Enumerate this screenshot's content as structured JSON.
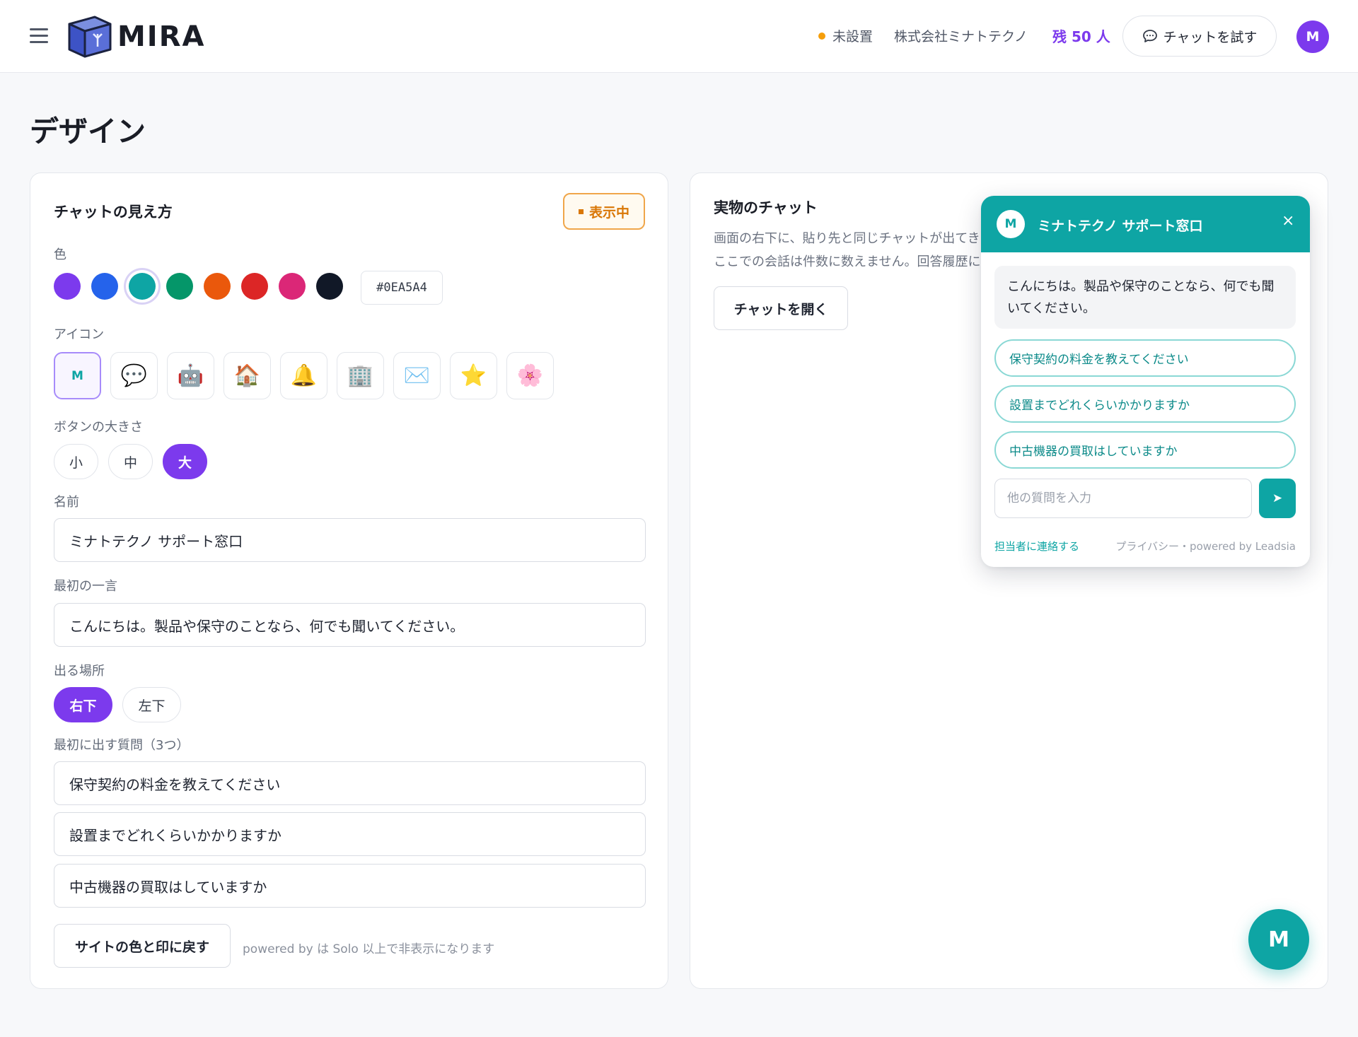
{
  "header": {
    "brand": "MIRA",
    "status": "未設置",
    "company": "株式会社ミナトテクノ",
    "remaining": "残 50 人",
    "try_chat": "チャットを試す",
    "avatar_initial": "M"
  },
  "page": {
    "title": "デザイン"
  },
  "appearance": {
    "title": "チャットの見え方",
    "badge": "表示中",
    "color_label": "色",
    "colors": [
      "#7c3aed",
      "#2563eb",
      "#0ea5a4",
      "#059669",
      "#ea580c",
      "#dc2626",
      "#db2777",
      "#111827"
    ],
    "selected_color": "#0EA5A4",
    "icon_label": "アイコン",
    "icons": [
      {
        "name": "letter-m",
        "glyph": "M"
      },
      {
        "name": "speech-bubble",
        "glyph": "💬"
      },
      {
        "name": "robot",
        "glyph": "🤖"
      },
      {
        "name": "house",
        "glyph": "🏠"
      },
      {
        "name": "bell",
        "glyph": "🔔"
      },
      {
        "name": "office-building",
        "glyph": "🏢"
      },
      {
        "name": "envelope",
        "glyph": "✉️"
      },
      {
        "name": "star",
        "glyph": "⭐"
      },
      {
        "name": "cherry-blossom",
        "glyph": "🌸"
      }
    ],
    "size_label": "ボタンの大きさ",
    "sizes": [
      "小",
      "中",
      "大"
    ],
    "selected_size": "大",
    "name_label": "名前",
    "name_value": "ミナトテクノ サポート窓口",
    "greeting_label": "最初の一言",
    "greeting_value": "こんにちは。製品や保守のことなら、何でも聞いてください。",
    "position_label": "出る場所",
    "positions": [
      "右下",
      "左下"
    ],
    "selected_position": "右下",
    "questions_label": "最初に出す質問（3つ）",
    "questions": [
      "保守契約の料金を教えてください",
      "設置までどれくらいかかりますか",
      "中古機器の買取はしていますか"
    ],
    "reset_button": "サイトの色と印に戻す",
    "powered_note": "powered by は Solo 以上で非表示になります"
  },
  "preview": {
    "title": "実物のチャット",
    "desc_line1": "画面の右下に、貼り先と同じチャットが出てきます。",
    "desc_line2": "ここでの会話は件数に数えません。回答履歴にも残りません。",
    "open_button": "チャットを開く"
  },
  "widget": {
    "avatar_initial": "M",
    "name": "ミナトテクノ サポート窓口",
    "close": "×",
    "greeting": "こんにちは。製品や保守のことなら、何でも聞いてください。",
    "suggestions": [
      "保守契約の料金を教えてください",
      "設置までどれくらいかかりますか",
      "中古機器の買取はしていますか"
    ],
    "input_placeholder": "他の質問を入力",
    "send_icon": "➤",
    "contact": "担当者に連絡する",
    "privacy": "プライバシー・powered by Leadsia",
    "launcher_initial": "M",
    "accent": "#0EA5A4"
  }
}
